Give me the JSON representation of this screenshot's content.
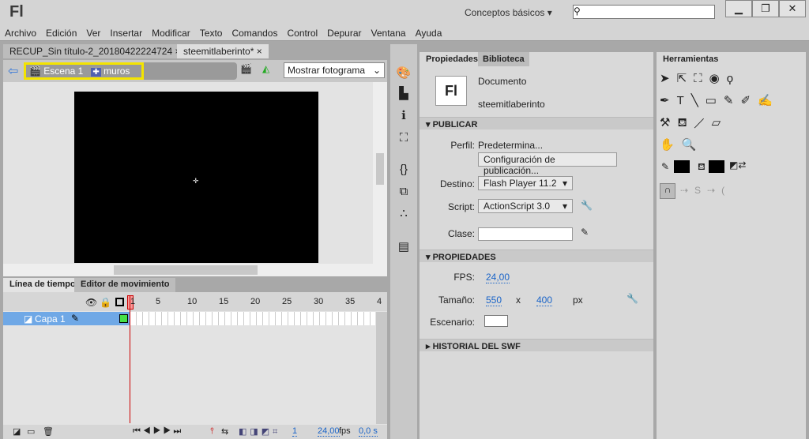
{
  "app": {
    "logo": "Fl",
    "workspace": "Conceptos básicos",
    "search_placeholder": "",
    "min": "▁",
    "max": "❐",
    "close": "✕"
  },
  "menu": [
    "Archivo",
    "Edición",
    "Ver",
    "Insertar",
    "Modificar",
    "Texto",
    "Comandos",
    "Control",
    "Depurar",
    "Ventana",
    "Ayuda"
  ],
  "doc_tabs": [
    {
      "label": "RECUP_Sin título-2_20180422224724",
      "close": "×"
    },
    {
      "label": "steemitlaberinto*",
      "close": "×"
    }
  ],
  "breadcrumb": {
    "scene": "Escena 1",
    "symbol": "muros"
  },
  "view_select": "Mostrar fotograma",
  "timeline": {
    "tabs": [
      "Línea de tiempo",
      "Editor de movimiento"
    ],
    "ticks": [
      "1",
      "5",
      "10",
      "15",
      "20",
      "25",
      "30",
      "35",
      "4"
    ],
    "layer": "Capa 1",
    "frame": "1",
    "fps": "24,00",
    "fps_unit": "fps",
    "time": "0,0 s"
  },
  "properties": {
    "tabs": [
      "Propiedades",
      "Biblioteca"
    ],
    "doc_icon": "Fl",
    "doc_type": "Documento",
    "doc_name": "steemitlaberinto",
    "publish_header": "PUBLICAR",
    "profile_label": "Perfil:",
    "profile": "Predetermina...",
    "publish_settings": "Configuración de publicación...",
    "target_label": "Destino:",
    "target": "Flash Player 11.2",
    "script_label": "Script:",
    "script": "ActionScript 3.0",
    "class_label": "Clase:",
    "class_value": "",
    "props_header": "PROPIEDADES",
    "fps_label": "FPS:",
    "fps": "24,00",
    "size_label": "Tamaño:",
    "width": "550",
    "x": "x",
    "height": "400",
    "unit": "px",
    "stage_label": "Escenario:",
    "stage_color": "#ffffff",
    "swf_header": "HISTORIAL DEL SWF"
  },
  "tools": {
    "title": "Herramientas",
    "stroke_color": "#000000",
    "fill_color": "#000000"
  }
}
